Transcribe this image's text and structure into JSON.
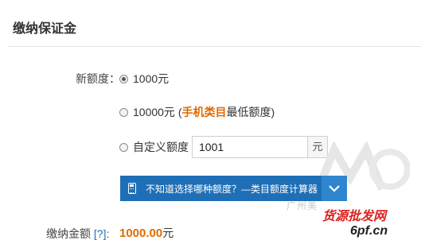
{
  "page": {
    "title": "缴纳保证金"
  },
  "quota": {
    "label": "新额度：",
    "options": [
      {
        "label": "1000元",
        "checked": true
      },
      {
        "label_prefix": "10000元 (",
        "label_highlight": "手机类目",
        "label_suffix": "最低额度)",
        "checked": false
      },
      {
        "label": "自定义额度",
        "checked": false
      }
    ],
    "custom_input": {
      "value": "1001",
      "unit": "元"
    }
  },
  "calculator": {
    "label": "不知道选择哪种额度？—类目额度计算器"
  },
  "payment": {
    "label": "缴纳金额",
    "help": "[?]",
    "colon": ":",
    "amount": "1000.00",
    "currency": "元"
  },
  "watermark": {
    "line1": "广州美",
    "line2": "货源批发网",
    "line3": "6pf.cn"
  },
  "colors": {
    "accent_orange": "#e06a00",
    "brand_blue": "#1f6fb6"
  },
  "icons": {
    "calculator": "calculator-icon",
    "chevron": "chevron-down-icon"
  }
}
